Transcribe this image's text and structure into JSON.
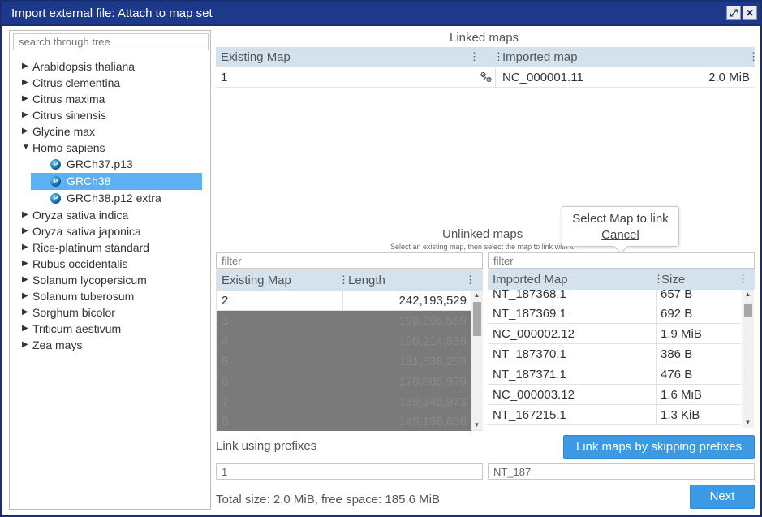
{
  "window": {
    "title": "Import external file: Attach to map set",
    "restore_glyph": "⤢",
    "close_glyph": "✕"
  },
  "tree": {
    "search_placeholder": "search through tree",
    "items": [
      {
        "label": "Arabidopsis thaliana",
        "expanded": false
      },
      {
        "label": "Citrus clementina",
        "expanded": false
      },
      {
        "label": "Citrus maxima",
        "expanded": false
      },
      {
        "label": "Citrus sinensis",
        "expanded": false
      },
      {
        "label": "Glycine max",
        "expanded": false
      },
      {
        "label": "Homo sapiens",
        "expanded": true
      },
      {
        "label": "Oryza sativa indica",
        "expanded": false
      },
      {
        "label": "Oryza sativa japonica",
        "expanded": false
      },
      {
        "label": "Rice-platinum standard",
        "expanded": false
      },
      {
        "label": "Rubus occidentalis",
        "expanded": false
      },
      {
        "label": "Solanum lycopersicum",
        "expanded": false
      },
      {
        "label": "Solanum tuberosum",
        "expanded": false
      },
      {
        "label": "Sorghum bicolor",
        "expanded": false
      },
      {
        "label": "Triticum aestivum",
        "expanded": false
      },
      {
        "label": "Zea mays",
        "expanded": false
      }
    ],
    "homo_children": [
      {
        "label": "GRCh37.p13",
        "icon": "P",
        "selected": false
      },
      {
        "label": "GRCh38",
        "icon": "P",
        "selected": true
      },
      {
        "label": "GRCh38.p12 extra",
        "icon": "P",
        "selected": false
      }
    ],
    "arrow_collapsed": "▶",
    "arrow_expanded": "▼"
  },
  "linked": {
    "title": "Linked maps",
    "col_existing": "Existing Map",
    "col_imported": "Imported map",
    "rows": [
      {
        "existing": "1",
        "imported": "NC_000001.11",
        "size": "2.0 MiB"
      }
    ]
  },
  "unlinked": {
    "title": "Unlinked maps",
    "hint": "Select an existing map, then select the map to link with it",
    "left_filter_placeholder": "filter",
    "right_filter_placeholder": "filter",
    "left_cols": {
      "existing": "Existing Map",
      "length": "Length"
    },
    "right_cols": {
      "imported": "Imported Map",
      "size": "Size"
    },
    "left_rows": [
      {
        "existing": "2",
        "length": "242,193,529"
      },
      {
        "existing": "3",
        "length": "198,295,559"
      },
      {
        "existing": "4",
        "length": "190,214,555"
      },
      {
        "existing": "5",
        "length": "181,538,259"
      },
      {
        "existing": "6",
        "length": "170,805,979"
      },
      {
        "existing": "7",
        "length": "159,345,973"
      },
      {
        "existing": "8",
        "length": "145,138,636"
      }
    ],
    "right_rows": [
      {
        "imported": "NT_187368.1",
        "size": "657 B"
      },
      {
        "imported": "NT_187369.1",
        "size": "692 B"
      },
      {
        "imported": "NC_000002.12",
        "size": "1.9 MiB"
      },
      {
        "imported": "NT_187370.1",
        "size": "386 B"
      },
      {
        "imported": "NT_187371.1",
        "size": "476 B"
      },
      {
        "imported": "NC_000003.12",
        "size": "1.6 MiB"
      },
      {
        "imported": "NT_167215.1",
        "size": "1.3 KiB"
      }
    ]
  },
  "popover": {
    "text": "Select Map to link",
    "cancel": "Cancel"
  },
  "prefix": {
    "label": "Link using prefixes",
    "button": "Link maps by skipping prefixes",
    "left_value": "1",
    "right_value": "NT_187"
  },
  "footer": {
    "status": "Total size: 2.0 MiB, free space: 185.6 MiB",
    "next": "Next"
  },
  "colors": {
    "titlebar": "#1d3a8a",
    "header": "#d4e2ee",
    "selected": "#5eb0f5",
    "button": "#3c9ae4"
  }
}
